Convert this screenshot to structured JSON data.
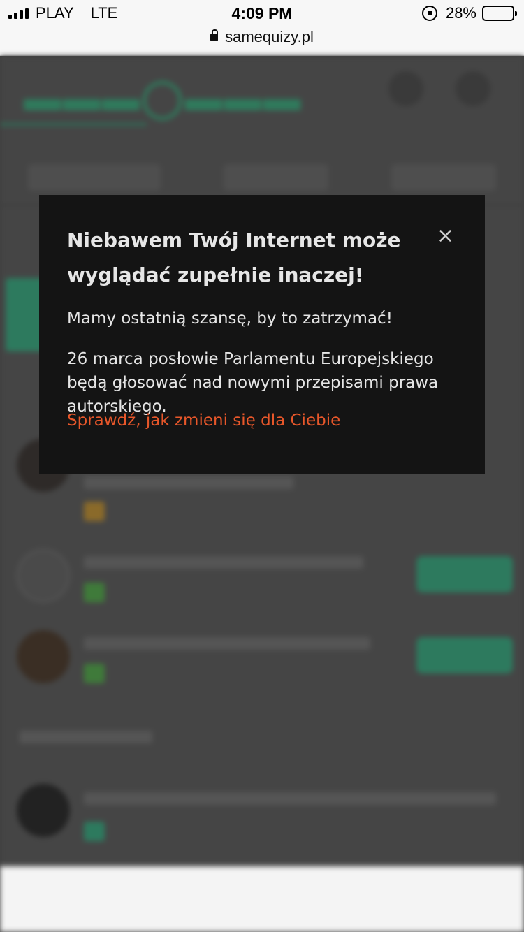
{
  "status_bar": {
    "carrier": "PLAY",
    "network": "LTE",
    "time": "4:09 PM",
    "battery": "28%",
    "battery_level": 0.28
  },
  "browser": {
    "url": "samequizy.pl"
  },
  "modal": {
    "title": "Niebawem Twój Internet może wyglądać zupełnie inaczej!",
    "close_glyph": "×",
    "paragraph1": "Mamy ostatnią szansę, by to zatrzymać!",
    "paragraph2": "26 marca posłowie Parlamentu Europejskiego będą głosować nad nowymi przepisami prawa autorskiego.",
    "link": "Sprawdź, jak zmieni się dla Ciebie",
    "link_color": "#e8572a"
  },
  "colors": {
    "brand_green": "#2d7a5e",
    "modal_bg": "#141414"
  }
}
